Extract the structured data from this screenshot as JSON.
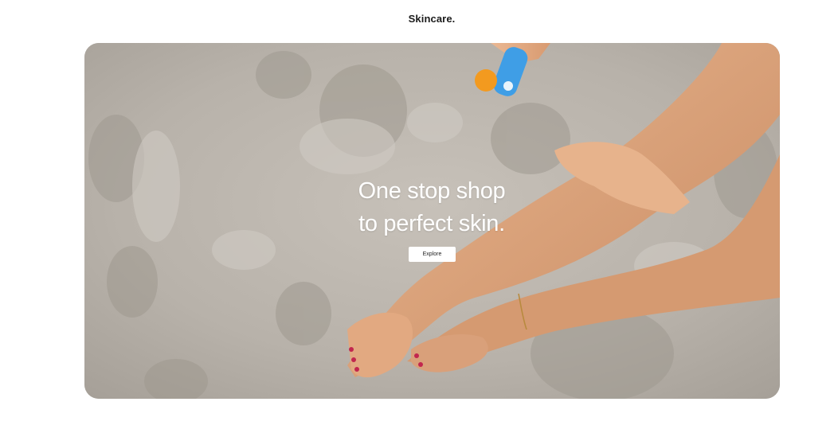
{
  "header": {
    "brand": "Skincare."
  },
  "hero": {
    "headline_line1": "One stop shop",
    "headline_line2": "to perfect skin.",
    "cta_label": "Explore",
    "image_description_icon": "beach-sunscreen-photo"
  },
  "colors": {
    "background": "#ffffff",
    "sand": "#b9b3ab",
    "skin": "#d9a27b",
    "bottle": "#3f9ee6",
    "cap": "#f39a1f",
    "polish": "#c2264e"
  }
}
